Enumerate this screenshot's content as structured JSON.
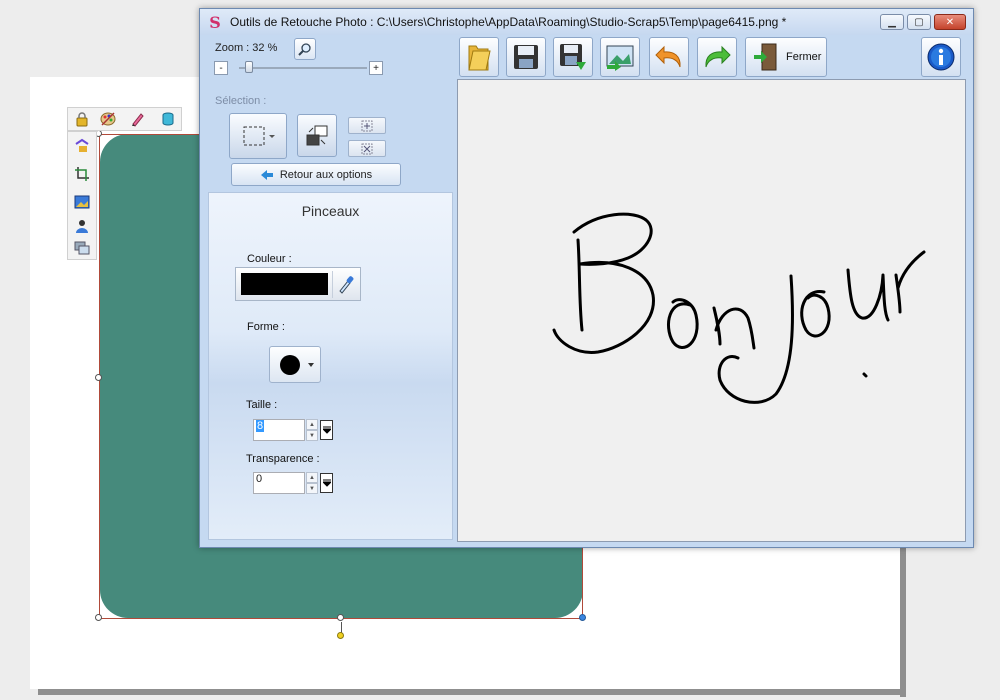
{
  "window": {
    "title": "Outils de Retouche Photo : C:\\Users\\Christophe\\AppData\\Roaming\\Studio-Scrap5\\Temp\\page6415.png *",
    "app_logo": "S",
    "controls": [
      "minimize-icon",
      "maximize-icon",
      "close-icon"
    ]
  },
  "left_panel": {
    "zoom_label": "Zoom :",
    "zoom_value": "32 %",
    "zoom_minus": "-",
    "zoom_plus": "+",
    "zoom_slider_value": 32,
    "selection_label": "Sélection :",
    "retour_label": "Retour aux options"
  },
  "brushes": {
    "title": "Pinceaux",
    "color_label": "Couleur :",
    "color_value": "#000000",
    "shape_label": "Forme :",
    "shape_value": "circle",
    "size_label": "Taille :",
    "size_value": "8",
    "transparency_label": "Transparence :",
    "transparency_value": "0"
  },
  "toolbar": {
    "buttons": [
      "open-folder-icon",
      "save-icon",
      "save-as-icon",
      "export-image-icon",
      "undo-icon",
      "redo-icon",
      "exit-door-icon"
    ],
    "close_label": "Fermer",
    "info_icon": "info-icon"
  },
  "canvas": {
    "handwritten_text": "Bonjour"
  },
  "colors": {
    "shape_fill": "#468a7c",
    "window_bg": "#c5d9f1",
    "canvas_bg": "#f0f0f0",
    "accent_pink": "#d12f6a"
  }
}
